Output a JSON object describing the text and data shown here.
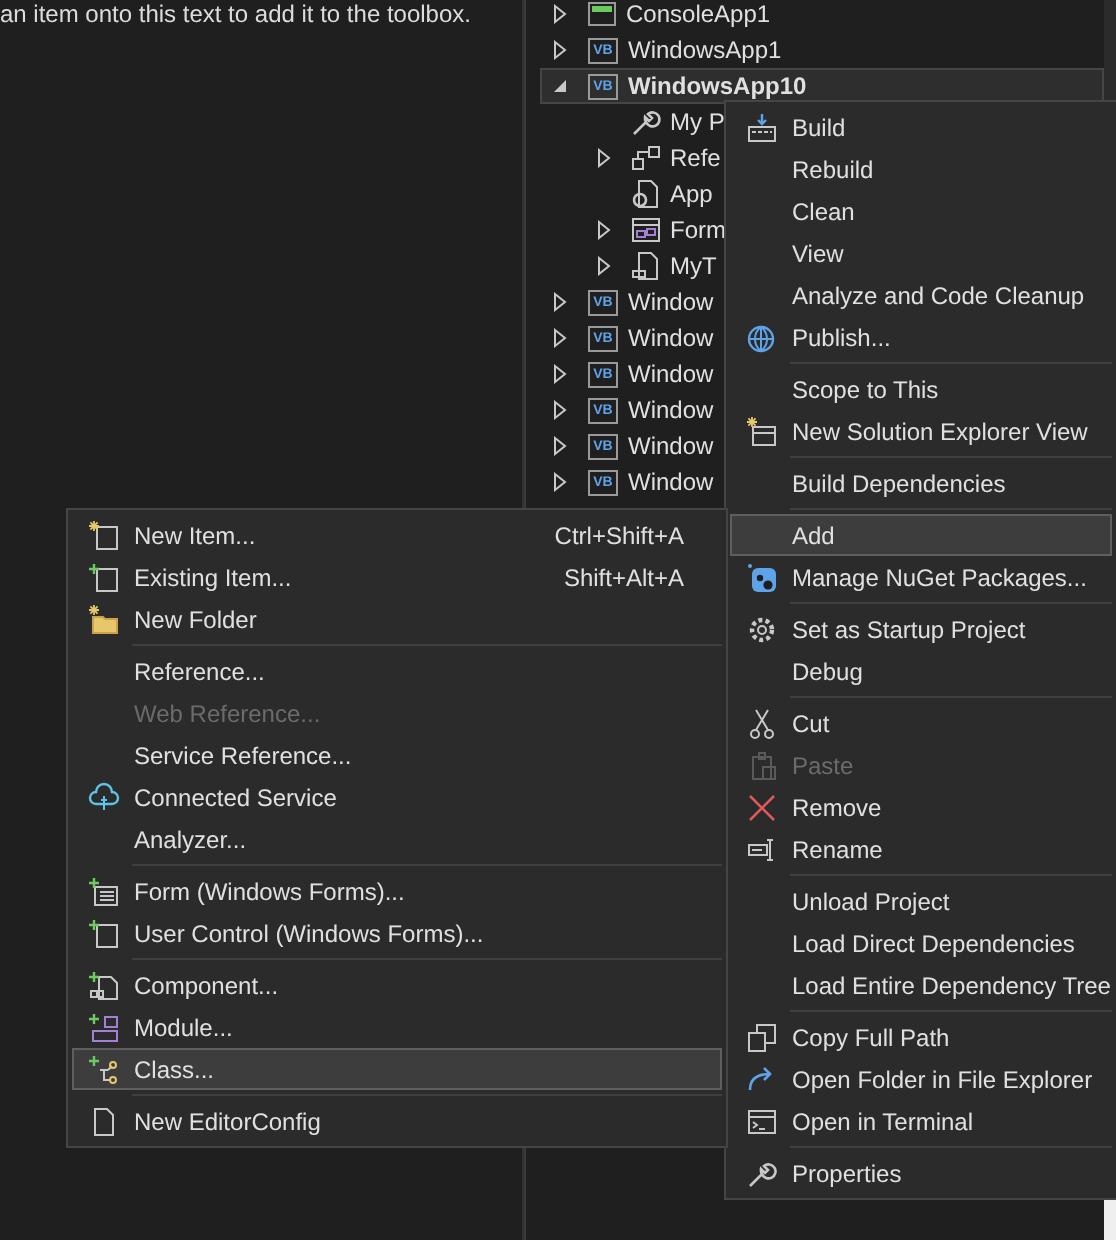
{
  "toolbox": {
    "hint": "an item onto this text to add it to the toolbox."
  },
  "solution_explorer": {
    "items": [
      {
        "label": "ConsoleApp1",
        "expanded": false,
        "selected": false
      },
      {
        "label": "WindowsApp1",
        "badge": "VB",
        "expanded": false,
        "selected": false
      },
      {
        "label": "WindowsApp10",
        "badge": "VB",
        "expanded": true,
        "selected": true,
        "children": [
          {
            "label": "My P",
            "selected": false
          },
          {
            "label": "Refe",
            "expanded": false,
            "selected": false
          },
          {
            "label": "App",
            "selected": false
          },
          {
            "label": "Form",
            "expanded": false,
            "selected": false
          },
          {
            "label": "MyT",
            "expanded": false,
            "selected": false
          }
        ]
      },
      {
        "label": "Window",
        "badge": "VB",
        "expanded": false,
        "selected": false
      },
      {
        "label": "Window",
        "badge": "VB",
        "expanded": false,
        "selected": false
      },
      {
        "label": "Window",
        "badge": "VB",
        "expanded": false,
        "selected": false
      },
      {
        "label": "Window",
        "badge": "VB",
        "expanded": false,
        "selected": false
      },
      {
        "label": "Window",
        "badge": "VB",
        "expanded": false,
        "selected": false
      },
      {
        "label": "Window",
        "badge": "VB",
        "expanded": false,
        "selected": false
      }
    ]
  },
  "project_menu": {
    "items": [
      {
        "kind": "item",
        "label": "Build",
        "disabled": false,
        "selected": false
      },
      {
        "kind": "item",
        "label": "Rebuild",
        "disabled": false,
        "selected": false
      },
      {
        "kind": "item",
        "label": "Clean",
        "disabled": false,
        "selected": false
      },
      {
        "kind": "item",
        "label": "View",
        "disabled": false,
        "selected": false
      },
      {
        "kind": "item",
        "label": "Analyze and Code Cleanup",
        "disabled": false,
        "selected": false
      },
      {
        "kind": "item",
        "label": "Publish...",
        "disabled": false,
        "selected": false
      },
      {
        "kind": "separator"
      },
      {
        "kind": "item",
        "label": "Scope to This",
        "disabled": false,
        "selected": false
      },
      {
        "kind": "item",
        "label": "New Solution Explorer View",
        "disabled": false,
        "selected": false
      },
      {
        "kind": "separator"
      },
      {
        "kind": "item",
        "label": "Build Dependencies",
        "disabled": false,
        "selected": false
      },
      {
        "kind": "separator"
      },
      {
        "kind": "item",
        "label": "Add",
        "disabled": false,
        "selected": true
      },
      {
        "kind": "item",
        "label": "Manage NuGet Packages...",
        "disabled": false,
        "selected": false
      },
      {
        "kind": "separator"
      },
      {
        "kind": "item",
        "label": "Set as Startup Project",
        "disabled": false,
        "selected": false
      },
      {
        "kind": "item",
        "label": "Debug",
        "disabled": false,
        "selected": false
      },
      {
        "kind": "separator"
      },
      {
        "kind": "item",
        "label": "Cut",
        "disabled": false,
        "selected": false
      },
      {
        "kind": "item",
        "label": "Paste",
        "disabled": true,
        "selected": false
      },
      {
        "kind": "item",
        "label": "Remove",
        "disabled": false,
        "selected": false
      },
      {
        "kind": "item",
        "label": "Rename",
        "disabled": false,
        "selected": false
      },
      {
        "kind": "separator"
      },
      {
        "kind": "item",
        "label": "Unload Project",
        "disabled": false,
        "selected": false
      },
      {
        "kind": "item",
        "label": "Load Direct Dependencies",
        "disabled": false,
        "selected": false
      },
      {
        "kind": "item",
        "label": "Load Entire Dependency Tree",
        "disabled": false,
        "selected": false
      },
      {
        "kind": "separator"
      },
      {
        "kind": "item",
        "label": "Copy Full Path",
        "disabled": false,
        "selected": false
      },
      {
        "kind": "item",
        "label": "Open Folder in File Explorer",
        "disabled": false,
        "selected": false
      },
      {
        "kind": "item",
        "label": "Open in Terminal",
        "disabled": false,
        "selected": false
      },
      {
        "kind": "separator"
      },
      {
        "kind": "item",
        "label": "Properties",
        "disabled": false,
        "selected": false
      }
    ]
  },
  "add_submenu": {
    "items": [
      {
        "kind": "item",
        "label": "New Item...",
        "shortcut": "Ctrl+Shift+A",
        "disabled": false,
        "selected": false
      },
      {
        "kind": "item",
        "label": "Existing Item...",
        "shortcut": "Shift+Alt+A",
        "disabled": false,
        "selected": false
      },
      {
        "kind": "item",
        "label": "New Folder",
        "disabled": false,
        "selected": false
      },
      {
        "kind": "separator"
      },
      {
        "kind": "item",
        "label": "Reference...",
        "disabled": false,
        "selected": false
      },
      {
        "kind": "item",
        "label": "Web Reference...",
        "disabled": true,
        "selected": false
      },
      {
        "kind": "item",
        "label": "Service Reference...",
        "disabled": false,
        "selected": false
      },
      {
        "kind": "item",
        "label": "Connected Service",
        "disabled": false,
        "selected": false
      },
      {
        "kind": "item",
        "label": "Analyzer...",
        "disabled": false,
        "selected": false
      },
      {
        "kind": "separator"
      },
      {
        "kind": "item",
        "label": "Form (Windows Forms)...",
        "disabled": false,
        "selected": false
      },
      {
        "kind": "item",
        "label": "User Control (Windows Forms)...",
        "disabled": false,
        "selected": false
      },
      {
        "kind": "separator"
      },
      {
        "kind": "item",
        "label": "Component...",
        "disabled": false,
        "selected": false
      },
      {
        "kind": "item",
        "label": "Module...",
        "disabled": false,
        "selected": false
      },
      {
        "kind": "item",
        "label": "Class...",
        "disabled": false,
        "selected": true
      },
      {
        "kind": "separator"
      },
      {
        "kind": "item",
        "label": "New EditorConfig",
        "disabled": false,
        "selected": false
      }
    ]
  }
}
